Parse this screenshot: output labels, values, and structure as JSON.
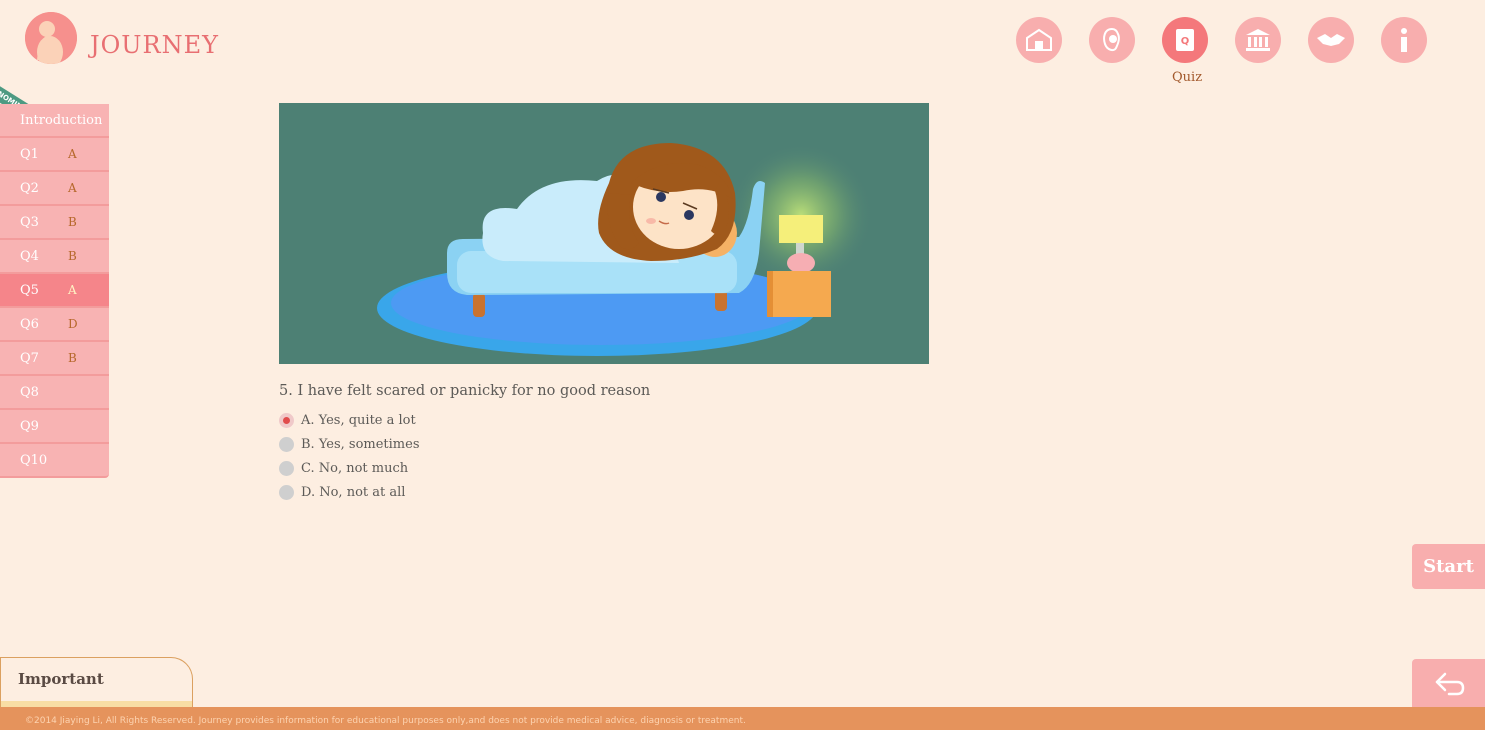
{
  "header": {
    "brand": "JOURNEY",
    "nav": [
      {
        "icon": "home-icon",
        "name": "nav-home"
      },
      {
        "icon": "profile-icon",
        "name": "nav-profile"
      },
      {
        "icon": "quiz-icon",
        "name": "nav-quiz",
        "active": true
      },
      {
        "icon": "bank-icon",
        "name": "nav-resources"
      },
      {
        "icon": "handshake-icon",
        "name": "nav-support"
      },
      {
        "icon": "info-icon",
        "name": "nav-info"
      }
    ],
    "active_caption": "Quiz"
  },
  "ribbon": "NOMIN",
  "sidebar": {
    "items": [
      {
        "q": "Introduction",
        "a": ""
      },
      {
        "q": "Q1",
        "a": "A"
      },
      {
        "q": "Q2",
        "a": "A"
      },
      {
        "q": "Q3",
        "a": "B"
      },
      {
        "q": "Q4",
        "a": "B"
      },
      {
        "q": "Q5",
        "a": "A"
      },
      {
        "q": "Q6",
        "a": "D"
      },
      {
        "q": "Q7",
        "a": "B"
      },
      {
        "q": "Q8",
        "a": ""
      },
      {
        "q": "Q9",
        "a": ""
      },
      {
        "q": "Q10",
        "a": ""
      }
    ],
    "active_index": 5
  },
  "question": {
    "text": "5. I have felt scared or panicky for no good reason",
    "options": [
      {
        "label": "A. Yes, quite a lot",
        "checked": true
      },
      {
        "label": "B.  Yes, sometimes",
        "checked": false
      },
      {
        "label": "C. No, not much",
        "checked": false
      },
      {
        "label": "D. No, not at all",
        "checked": false
      }
    ]
  },
  "buttons": {
    "start": "Start",
    "back_icon": "back-arrow-icon"
  },
  "important": {
    "label": "Important"
  },
  "footer": {
    "text": "©2014 Jiaying Li, All Rights Reserved. Journey provides information for educational purposes only,and does not provide medical advice, diagnosis or treatment."
  },
  "colors": {
    "background": "#fdeee1",
    "brand": "#e86f72",
    "nav": "#f8aeae",
    "nav_active": "#f4787b",
    "footer": "#e5935c",
    "answer": "#b5672a"
  }
}
